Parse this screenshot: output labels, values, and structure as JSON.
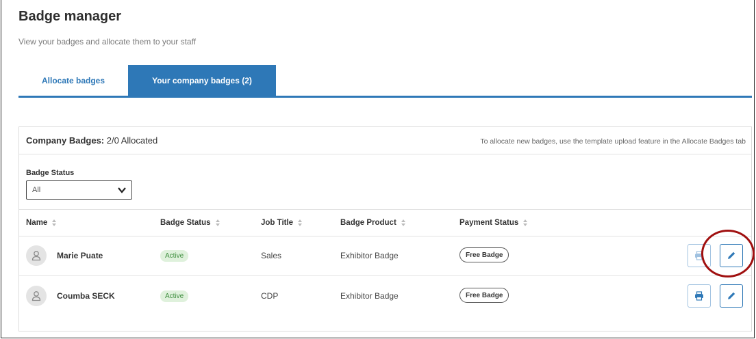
{
  "header": {
    "title": "Badge manager",
    "subtitle": "View your badges and allocate them to your staff"
  },
  "tabs": [
    {
      "label": "Allocate badges",
      "active": false
    },
    {
      "label": "Your company badges (2)",
      "active": true
    }
  ],
  "panel": {
    "company_badges_label": "Company Badges:",
    "company_badges_value": "2/0 Allocated",
    "hint": "To allocate new badges, use the template upload feature in the Allocate Badges tab",
    "filter": {
      "label": "Badge Status",
      "selected": "All"
    },
    "columns": [
      "Name",
      "Badge Status",
      "Job Title",
      "Badge Product",
      "Payment Status"
    ],
    "rows": [
      {
        "name": "Marie Puate",
        "status": "Active",
        "job_title": "Sales",
        "product": "Exhibitor Badge",
        "payment": "Free Badge"
      },
      {
        "name": "Coumba SECK",
        "status": "Active",
        "job_title": "CDP",
        "product": "Exhibitor Badge",
        "payment": "Free Badge"
      }
    ]
  },
  "colors": {
    "accent": "#2e78b7",
    "active_text": "#3e8e3e",
    "active_bg": "#dff1dc",
    "highlight_circle": "#a01010"
  },
  "icons": {
    "avatar": "user-icon",
    "print": "printer-icon",
    "edit": "pencil-icon",
    "sort": "sort-icon",
    "chevron": "chevron-down-icon"
  }
}
